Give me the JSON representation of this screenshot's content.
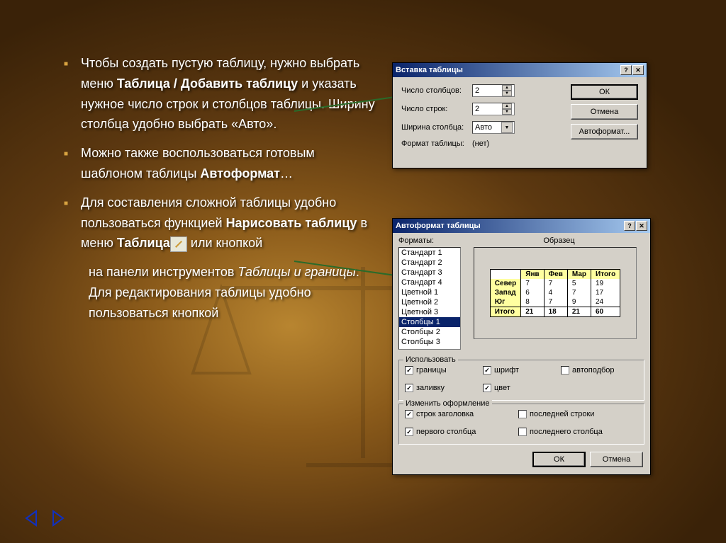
{
  "bullets": [
    {
      "pre": "Чтобы создать пустую таблицу,  нужно выбрать меню ",
      "bold1": "Таблица / Добавить таблицу",
      "post": " и указать  нужное число строк и столбцов таблицы. Ширину столбца удобно выбрать «Авто»."
    },
    {
      "pre": "Можно также воспользоваться готовым шаблоном таблицы ",
      "bold1": "Автоформат",
      "post": "…"
    },
    {
      "pre": "Для составления сложной таблицы удобно пользоваться функцией ",
      "bold1": "Нарисовать таблицу",
      "mid": " в меню ",
      "bold2": "Таблица",
      "post": " или кнопкой"
    }
  ],
  "subtext": {
    "pre": "на панели инструментов ",
    "italic": "Таблицы и границы",
    "post": ". Для редактирования таблицы удобно пользоваться кнопкой"
  },
  "dialog1": {
    "title": "Вставка таблицы",
    "labels": {
      "cols": "Число столбцов:",
      "rows": "Число строк:",
      "width": "Ширина столбца:",
      "format": "Формат таблицы:"
    },
    "values": {
      "cols": "2",
      "rows": "2",
      "width": "Авто",
      "format": "(нет)"
    },
    "buttons": {
      "ok": "ОК",
      "cancel": "Отмена",
      "autoformat": "Автоформат..."
    }
  },
  "dialog2": {
    "title": "Автоформат таблицы",
    "formats_label": "Форматы:",
    "sample_label": "Образец",
    "formats": [
      "Стандарт 1",
      "Стандарт 2",
      "Стандарт 3",
      "Стандарт 4",
      "Цветной 1",
      "Цветной 2",
      "Цветной 3",
      "Столбцы 1",
      "Столбцы 2",
      "Столбцы 3"
    ],
    "selected_format": "Столбцы 1",
    "sample": {
      "headers": [
        "",
        "Янв",
        "Фев",
        "Мар",
        "Итого"
      ],
      "rows": [
        [
          "Север",
          "7",
          "7",
          "5",
          "19"
        ],
        [
          "Запад",
          "6",
          "4",
          "7",
          "17"
        ],
        [
          "Юг",
          "8",
          "7",
          "9",
          "24"
        ],
        [
          "Итого",
          "21",
          "18",
          "21",
          "60"
        ]
      ]
    },
    "group1": {
      "title": "Использовать",
      "checks": [
        {
          "label": "границы",
          "checked": true
        },
        {
          "label": "шрифт",
          "checked": true
        },
        {
          "label": "автоподбор",
          "checked": false
        },
        {
          "label": "заливку",
          "checked": true
        },
        {
          "label": "цвет",
          "checked": true
        }
      ]
    },
    "group2": {
      "title": "Изменить оформление",
      "checks": [
        {
          "label": "строк заголовка",
          "checked": true
        },
        {
          "label": "последней строки",
          "checked": false
        },
        {
          "label": "первого столбца",
          "checked": true
        },
        {
          "label": "последнего столбца",
          "checked": false
        }
      ]
    },
    "buttons": {
      "ok": "ОК",
      "cancel": "Отмена"
    }
  }
}
